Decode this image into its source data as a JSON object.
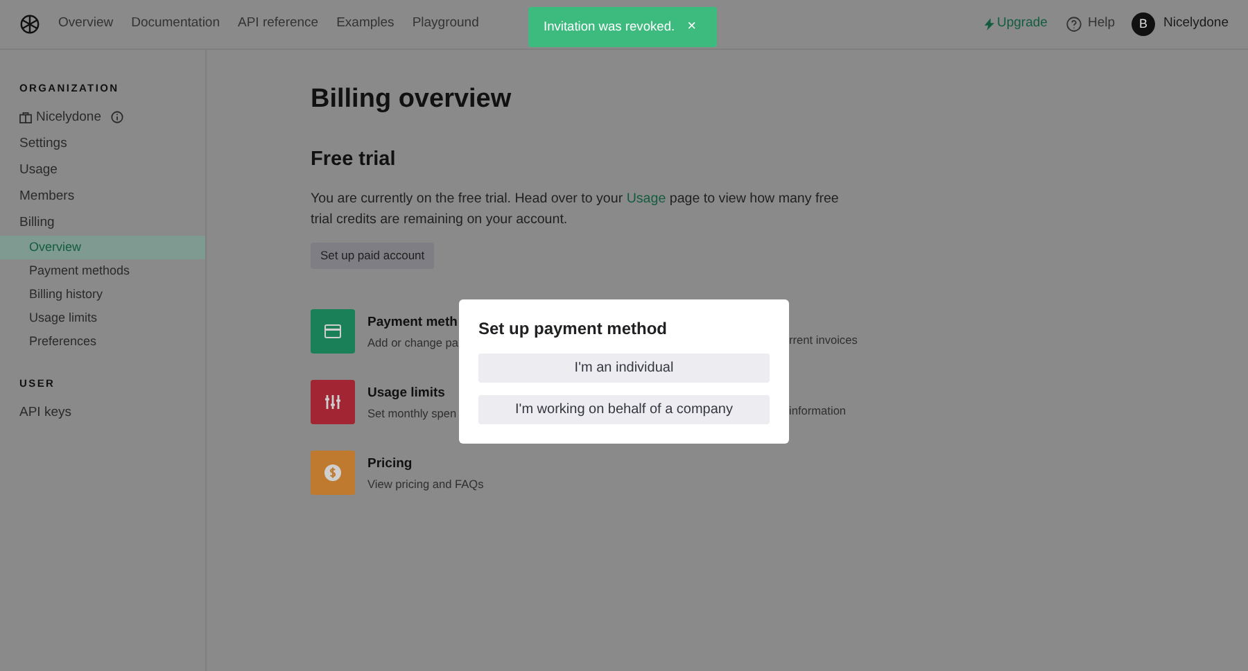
{
  "topnav": {
    "links": [
      {
        "label": "Overview"
      },
      {
        "label": "Documentation"
      },
      {
        "label": "API reference"
      },
      {
        "label": "Examples"
      },
      {
        "label": "Playground"
      }
    ],
    "upgrade": "Upgrade",
    "help": "Help",
    "avatar_initial": "B",
    "user": "Nicelydone"
  },
  "toast": {
    "message": "Invitation was revoked.",
    "close": "×"
  },
  "sidebar": {
    "sections": [
      {
        "heading": "ORGANIZATION",
        "org": "Nicelydone",
        "items": [
          {
            "label": "Settings",
            "selected": false
          },
          {
            "label": "Usage",
            "selected": false
          },
          {
            "label": "Members",
            "selected": false
          },
          {
            "label": "Billing",
            "selected": false,
            "children": [
              {
                "label": "Overview",
                "selected": true
              },
              {
                "label": "Payment methods",
                "selected": false
              },
              {
                "label": "Billing history",
                "selected": false
              },
              {
                "label": "Usage limits",
                "selected": false
              },
              {
                "label": "Preferences",
                "selected": false
              }
            ]
          }
        ]
      },
      {
        "heading": "USER",
        "items": [
          {
            "label": "API keys",
            "selected": false
          }
        ]
      }
    ]
  },
  "page": {
    "title": "Billing overview",
    "section_title": "Free trial",
    "text_before": "You are currently on the free trial. Head over to your",
    "link": "Usage",
    "text_after": "page to view how many free trial credits are remaining on your account.",
    "button": "Set up paid account",
    "cards": [
      {
        "kind": "card",
        "color": "#198058",
        "title": "Payment meth",
        "description": "Add or change pa",
        "right_fragment": "rrent invoices"
      },
      {
        "kind": "sliders",
        "color": "#a12533",
        "title": "Usage limits",
        "description": "Set monthly spen",
        "right_fragment": "information"
      },
      {
        "kind": "dollar",
        "color": "#c07a30",
        "title": "Pricing",
        "description": "View pricing and FAQs"
      }
    ]
  },
  "modal": {
    "title": "Set up payment method",
    "options": [
      {
        "label": "I'm an individual"
      },
      {
        "label": "I'm working on behalf of a company"
      }
    ]
  }
}
